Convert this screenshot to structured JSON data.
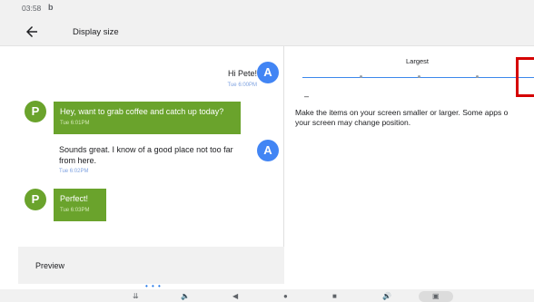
{
  "status_bar": {
    "time": "03:58",
    "notification_icon": "b"
  },
  "app_bar": {
    "title": "Display size",
    "back_icon": "arrow-back-icon"
  },
  "preview": {
    "messages": [
      {
        "text": "Hi Pete!",
        "time": "Tue 6:00PM",
        "avatar": "A"
      },
      {
        "text": "Hey, want to grab coffee and catch up today?",
        "time": "Tue 6:01PM",
        "avatar": "P"
      },
      {
        "text_line1": "Sounds great. I know of a good place not too far",
        "text_line2": "from here.",
        "time": "Tue 6:02PM",
        "avatar": "A"
      },
      {
        "text": "Perfect!",
        "time": "Tue 6:03PM",
        "avatar": "P"
      }
    ],
    "label": "Preview"
  },
  "settings": {
    "size_label": "Largest",
    "minus_symbol": "–",
    "description_line1": "Make the items on your screen smaller or larger. Some apps o",
    "description_line2": "your screen may change position."
  },
  "nav_bar": {
    "page_dots": "• • •",
    "icons": [
      "chevron-down-icon",
      "volume-down-icon",
      "back-icon",
      "home-icon",
      "recents-icon",
      "volume-up-icon",
      "screenshot-icon"
    ]
  },
  "colors": {
    "accent": "#4285f4",
    "bubble_green": "#6aa32c",
    "highlight": "#d50000"
  }
}
